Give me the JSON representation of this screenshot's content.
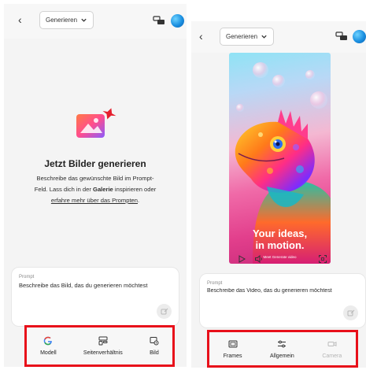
{
  "left": {
    "back": "‹",
    "dropdown_label": "Generieren",
    "heading": "Jetzt Bilder generieren",
    "desc_line1": "Beschreibe das gewünschte Bild im Prompt-",
    "desc_line2a": "Feld. Lass dich in der ",
    "desc_bold": "Galerie",
    "desc_line2b": " inspirieren oder",
    "desc_link": "erfahre mehr über das Prompten",
    "desc_end": ".",
    "prompt_label": "Prompt",
    "prompt_placeholder": "Beschreibe das Bild, das du generieren möchtest",
    "tools": [
      {
        "label": "Modell",
        "icon": "g-logo-icon"
      },
      {
        "label": "Seitenverhältnis",
        "icon": "aspect-ratio-icon"
      },
      {
        "label": "Bild",
        "icon": "image-settings-icon"
      }
    ]
  },
  "right": {
    "back": "‹",
    "dropdown_label": "Generieren",
    "video_title_1": "Your ideas,",
    "video_title_2": "in motion.",
    "video_sub": "Meet Generate video",
    "prompt_label": "Prompt",
    "prompt_placeholder": "Beschreibe das Video, das du generieren möchtest",
    "tools": [
      {
        "label": "Frames",
        "icon": "frames-icon",
        "enabled": true
      },
      {
        "label": "Allgemein",
        "icon": "sliders-icon",
        "enabled": true
      },
      {
        "label": "Camera",
        "icon": "camera-icon",
        "enabled": false
      }
    ]
  },
  "colors": {
    "highlight": "#e8101a",
    "background": "#f4f4f4",
    "accent_red": "#e5202e"
  }
}
